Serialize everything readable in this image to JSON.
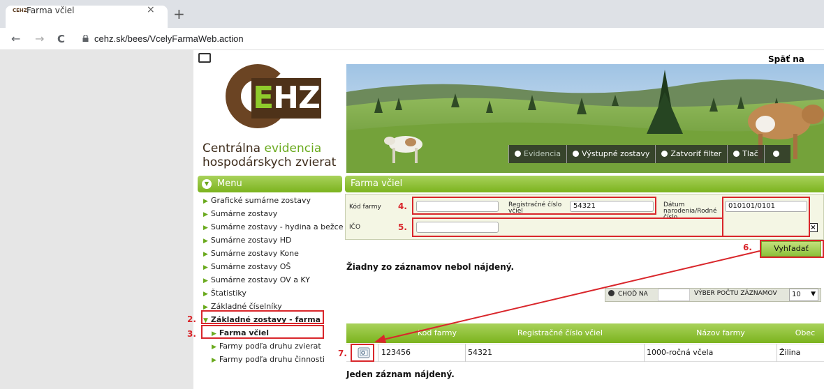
{
  "browser": {
    "tab_favicon": "CEHZ",
    "tab_title": "Farma včiel",
    "tab_close": "×",
    "new_tab": "+",
    "back": "←",
    "forward": "→",
    "reload": "C",
    "url": "cehz.sk/bees/VcelyFarmaWeb.action"
  },
  "header": {
    "back_link": "Späť na úvod"
  },
  "logo": {
    "mark_e": "E",
    "mark_hz": "HZ",
    "line1_a": "Centrálna ",
    "line1_b": "evidencia",
    "line2": "hospodárskych zvierat"
  },
  "banner_nav": [
    {
      "label": "Evidencia",
      "dim": true
    },
    {
      "label": "Výstupné zostavy",
      "dim": false
    },
    {
      "label": "Zatvoriť filter",
      "dim": false
    },
    {
      "label": "Tlač",
      "dim": false
    },
    {
      "label": "",
      "dim": false
    }
  ],
  "menu": {
    "title": "Menu",
    "items": [
      "Grafické sumárne zostavy",
      "Sumárne zostavy",
      "Sumárne zostavy - hydina a bežce",
      "Sumárne zostavy HD",
      "Sumárne zostavy Kone",
      "Sumárne zostavy OŠ",
      "Sumárne zostavy OV a KY",
      "Štatistiky",
      "Základné číselníky"
    ],
    "open_section": "Základné zostavy - farma",
    "sub_items": [
      "Farma včiel",
      "Farmy podľa druhu zvierat",
      "Farmy podľa druhu činnosti"
    ]
  },
  "panel": {
    "title": "Farma včiel",
    "filter": {
      "farm_code_label": "Kód farmy",
      "farm_code_value": "",
      "reg_label_1": "Registračné číslo",
      "reg_label_2": "včiel",
      "reg_value": "54321",
      "birth_label_1": "Dátum",
      "birth_label_2": "narodenia/Rodné",
      "birth_label_3": "číslo",
      "birth_value": "010101/0101",
      "ico_label": "IČO",
      "ico_value": "",
      "close_x": "×"
    },
    "search_button": "Vyhľadať",
    "no_records": "Žiadny zo záznamov nebol nájdený.",
    "pager": {
      "go_label": "CHOĎ NA",
      "page_size_label": "VÝBER POČTU ZÁZNAMOV",
      "page_size_value": "10"
    },
    "table": {
      "columns": [
        "Kód farmy",
        "Registračné číslo včiel",
        "Názov farmy",
        "Obec"
      ],
      "rows": [
        {
          "code": "123456",
          "reg": "54321",
          "name": "1000-ročná včela",
          "town": "Žilina"
        }
      ]
    },
    "found": "Jeden záznam nájdený."
  },
  "annotations": {
    "n2": "2.",
    "n3": "3.",
    "n4": "4.",
    "n5": "5.",
    "n6": "6.",
    "n7": "7.",
    "color": "#d9262b"
  }
}
